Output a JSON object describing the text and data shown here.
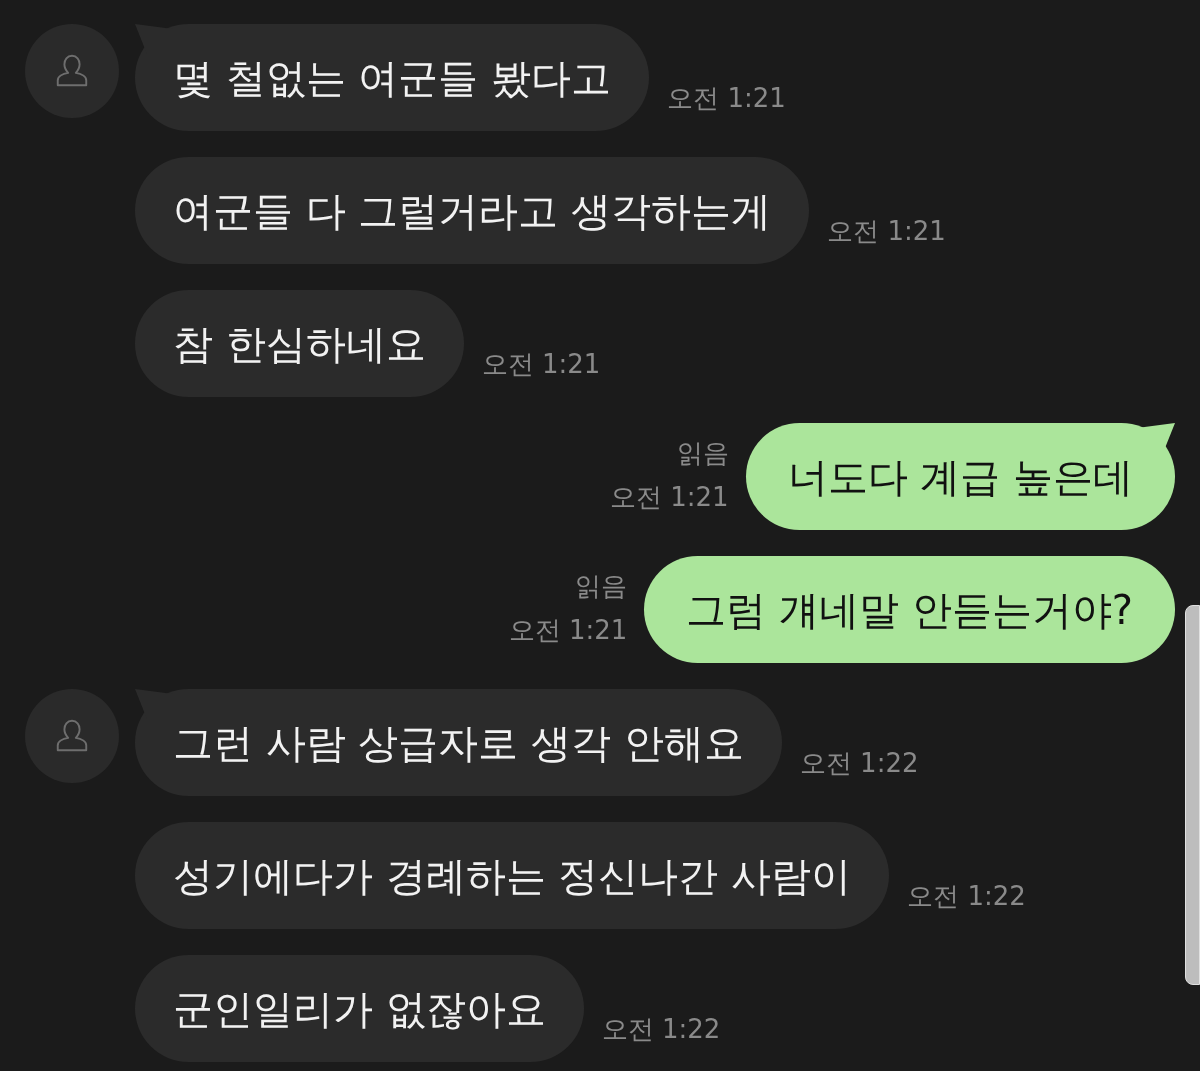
{
  "messages": [
    {
      "kind": "incoming",
      "first_in_group": true,
      "text": "몇 철없는 여군들 봤다고",
      "time": "오전 1:21"
    },
    {
      "kind": "incoming",
      "first_in_group": false,
      "text": "여군들 다 그럴거라고 생각하는게",
      "time": "오전 1:21"
    },
    {
      "kind": "incoming",
      "first_in_group": false,
      "text": "참 한심하네요",
      "time": "오전 1:21"
    },
    {
      "kind": "outgoing",
      "first_in_group": true,
      "read_label": "읽음",
      "text": "너도다 계급 높은데",
      "time": "오전 1:21"
    },
    {
      "kind": "outgoing",
      "first_in_group": false,
      "read_label": "읽음",
      "text": "그럼 걔네말 안듣는거야?",
      "time": "오전 1:21"
    },
    {
      "kind": "incoming",
      "first_in_group": true,
      "text": "그런 사람 상급자로 생각 안해요",
      "time": "오전 1:22"
    },
    {
      "kind": "incoming",
      "first_in_group": false,
      "text": "성기에다가 경례하는 정신나간 사람이",
      "time": "오전 1:22"
    },
    {
      "kind": "incoming",
      "first_in_group": false,
      "text": "군인일리가 없잖아요",
      "time": "오전 1:22"
    }
  ]
}
